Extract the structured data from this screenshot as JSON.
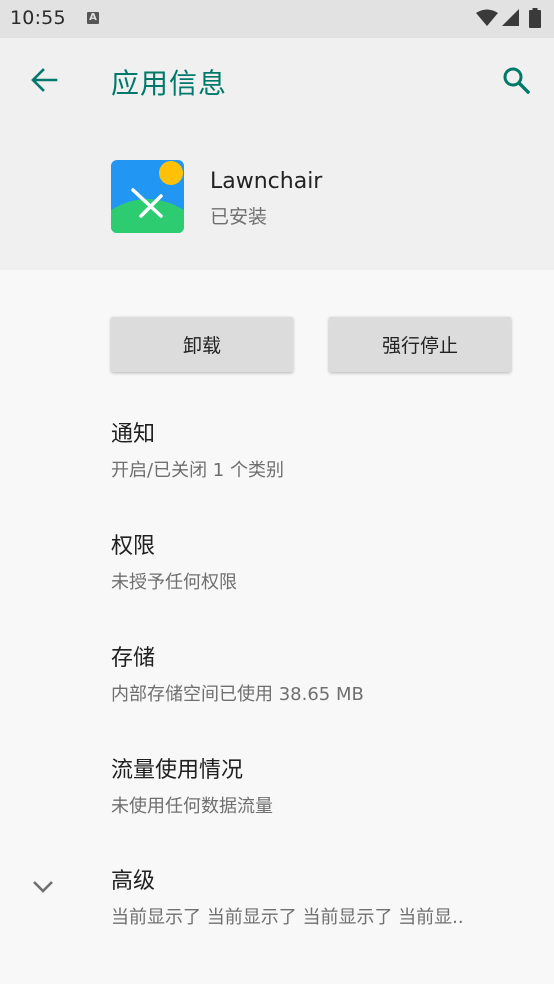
{
  "status_bar": {
    "time": "10:55",
    "notification_icon": "a-icon"
  },
  "header": {
    "title": "应用信息",
    "back_icon": "arrow-back-icon",
    "search_icon": "search-icon",
    "accent_color": "#00796b"
  },
  "app": {
    "name": "Lawnchair",
    "status": "已安装"
  },
  "buttons": {
    "uninstall": "卸载",
    "force_stop": "强行停止"
  },
  "items": [
    {
      "title": "通知",
      "summary": "开启/已关闭 1 个类别"
    },
    {
      "title": "权限",
      "summary": "未授予任何权限"
    },
    {
      "title": "存储",
      "summary": "内部存储空间已使用 38.65 MB"
    },
    {
      "title": "流量使用情况",
      "summary": "未使用任何数据流量"
    },
    {
      "title": "高级",
      "summary": "当前显示了 当前显示了 当前显示了 当前显.."
    }
  ]
}
